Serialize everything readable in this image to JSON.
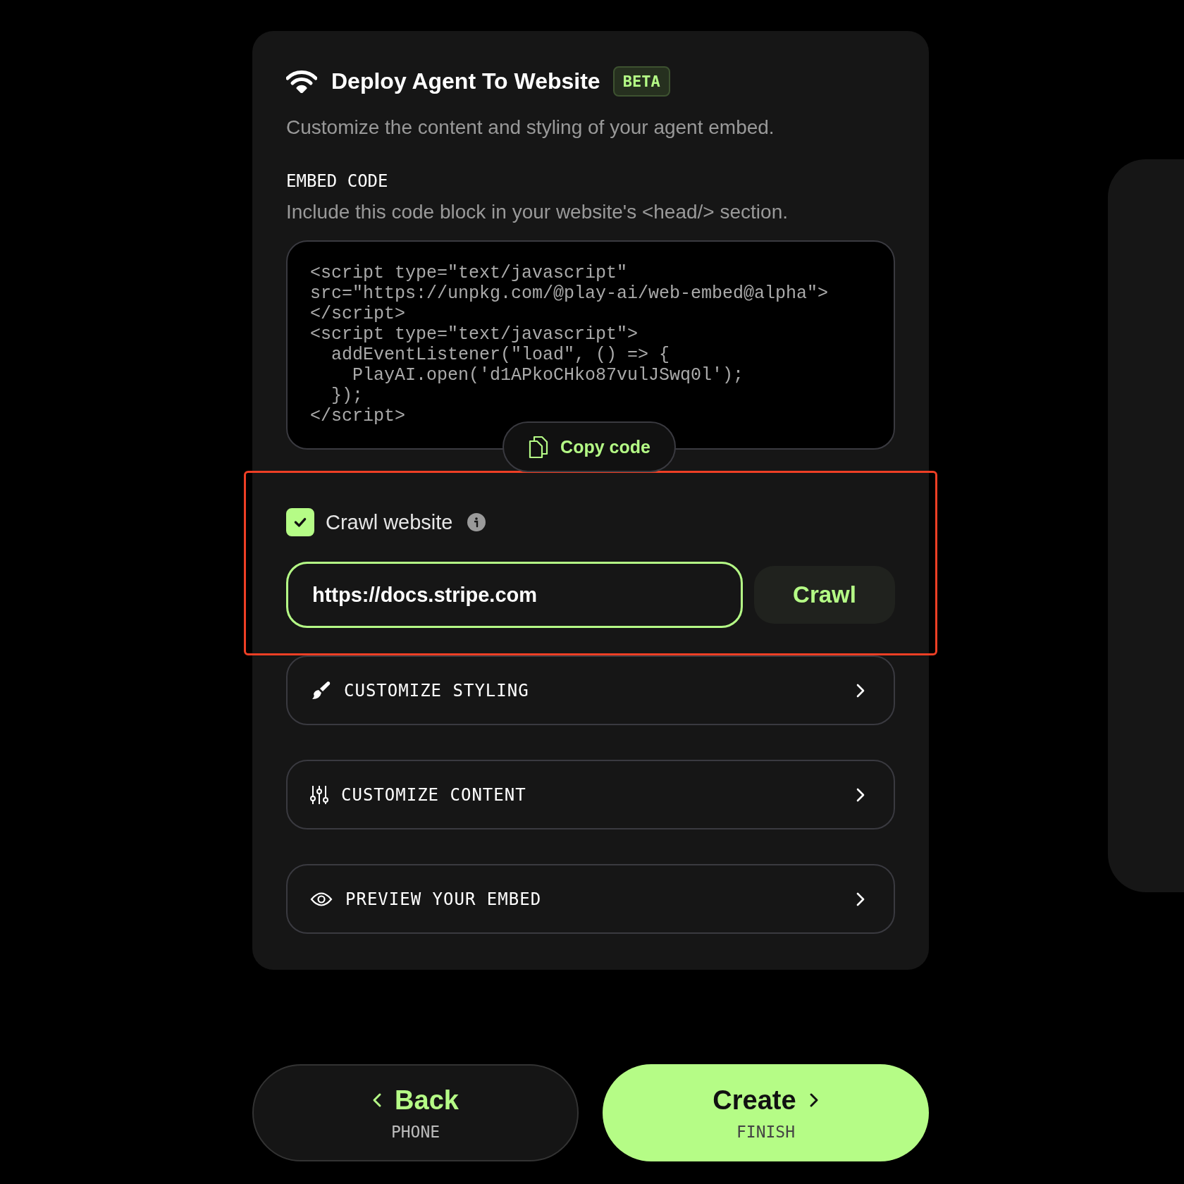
{
  "header": {
    "title": "Deploy Agent To Website",
    "badge": "BETA",
    "subtitle": "Customize the content and styling of your agent embed."
  },
  "embed": {
    "heading": "EMBED CODE",
    "hint": "Include this code block in your website's <head/> section.",
    "code": [
      "<script type=\"text/javascript\"",
      "src=\"https://unpkg.com/@play-ai/web-embed@alpha\">",
      "</script>",
      "<script type=\"text/javascript\">",
      "  addEventListener(\"load\", () => {",
      "    PlayAI.open('d1APkoCHko87vulJSwq0l');",
      "  });",
      "</script>"
    ],
    "copy_button": "Copy code"
  },
  "crawl": {
    "highlighted": true,
    "label": "Crawl website",
    "checked": true,
    "url": "https://docs.stripe.com",
    "focused": true,
    "button": "Crawl"
  },
  "sections": [
    {
      "kind": "brush",
      "label": "CUSTOMIZE STYLING"
    },
    {
      "kind": "sliders",
      "label": "CUSTOMIZE CONTENT"
    },
    {
      "kind": "eye",
      "label": "PREVIEW YOUR EMBED"
    }
  ],
  "footer": {
    "back": {
      "label": "Back",
      "step": "PHONE"
    },
    "create": {
      "label": "Create",
      "step": "FINISH"
    }
  }
}
